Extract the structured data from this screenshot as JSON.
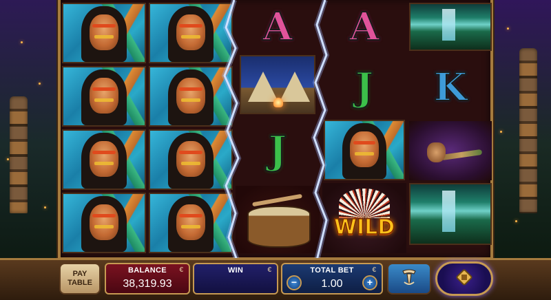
{
  "game": {
    "wild_label": "WILD"
  },
  "reels": [
    [
      "chief",
      "chief",
      "chief",
      "chief"
    ],
    [
      "chief",
      "chief",
      "chief",
      "chief"
    ],
    [
      "letter-a",
      "teepee",
      "letter-j",
      "drum"
    ],
    [
      "letter-a",
      "letter-j",
      "chief",
      "wild"
    ],
    [
      "waterfall",
      "letter-k",
      "pipe",
      "waterfall"
    ]
  ],
  "letters": {
    "a": "A",
    "j": "J",
    "k": "K"
  },
  "panel": {
    "paytable_label_line1": "PAY",
    "paytable_label_line2": "TABLE",
    "balance_label": "BALANCE",
    "balance_value": "38,319.93",
    "win_label": "WIN",
    "win_value": "",
    "total_bet_label": "TOTAL BET",
    "total_bet_value": "1.00",
    "currency_symbol": "€",
    "minus_label": "−",
    "plus_label": "+"
  },
  "colors": {
    "frame": "#a57b3e",
    "balance_bg": "#7a1220",
    "win_bg": "#22206a",
    "bet_bg": "#1c3a72",
    "wild_text": "#ffc21a"
  },
  "icons": {
    "autoplay": "feather-scroll-icon",
    "spin": "spin-icon"
  }
}
